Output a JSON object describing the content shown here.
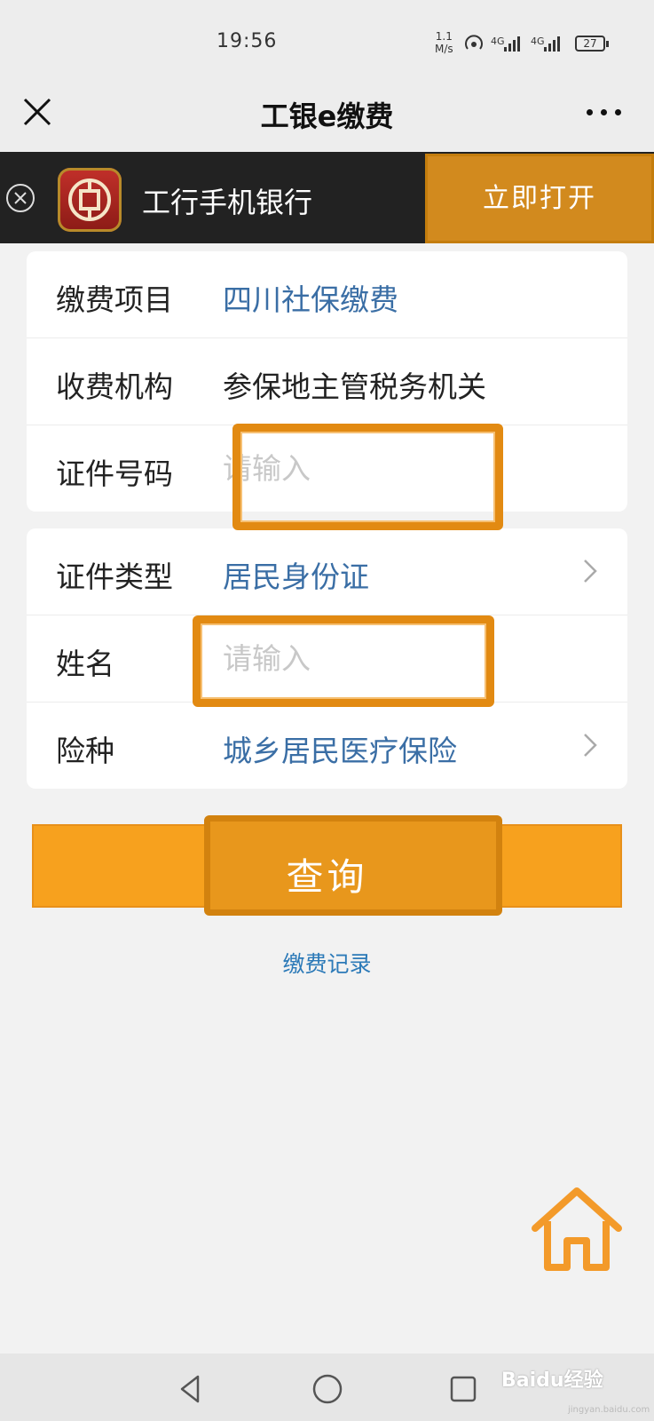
{
  "status_bar": {
    "time": "19:56",
    "net_speed_value": "1.1",
    "net_speed_unit": "M/s",
    "sim1": "4G",
    "sim2": "4G",
    "battery": "27",
    "icons": [
      "hotspot-icon",
      "signal-icon",
      "battery-icon"
    ]
  },
  "nav": {
    "title": "工银e缴费",
    "icons": [
      "close-icon",
      "more-icon"
    ]
  },
  "banner": {
    "app_name": "工行手机银行",
    "open_label": "立即打开",
    "icons": [
      "close-circle-icon",
      "icbc-logo"
    ]
  },
  "form": {
    "group1": [
      {
        "label": "缴费项目",
        "value": "四川社保缴费"
      },
      {
        "label": "收费机构",
        "value": "参保地主管税务机关"
      },
      {
        "label": "证件号码",
        "placeholder": "请输入",
        "value": ""
      }
    ],
    "group2": [
      {
        "label": "证件类型",
        "value": "居民身份证"
      },
      {
        "label": "姓名",
        "placeholder": "请输入",
        "value": ""
      },
      {
        "label": "险种",
        "value": "城乡居民医疗保险"
      }
    ]
  },
  "query_label": "查询",
  "records_link": "缴费记录",
  "home_icon": "home-icon",
  "system_nav": [
    "back-icon",
    "home-circle-icon",
    "recents-icon"
  ],
  "watermark": {
    "text": "Baidu经验",
    "url_text": "jingyan.baidu.com"
  },
  "colors": {
    "accent": "#f7a11e",
    "highlight": "#e28a12",
    "link": "#3a6ea5",
    "banner_bg": "#222222"
  }
}
